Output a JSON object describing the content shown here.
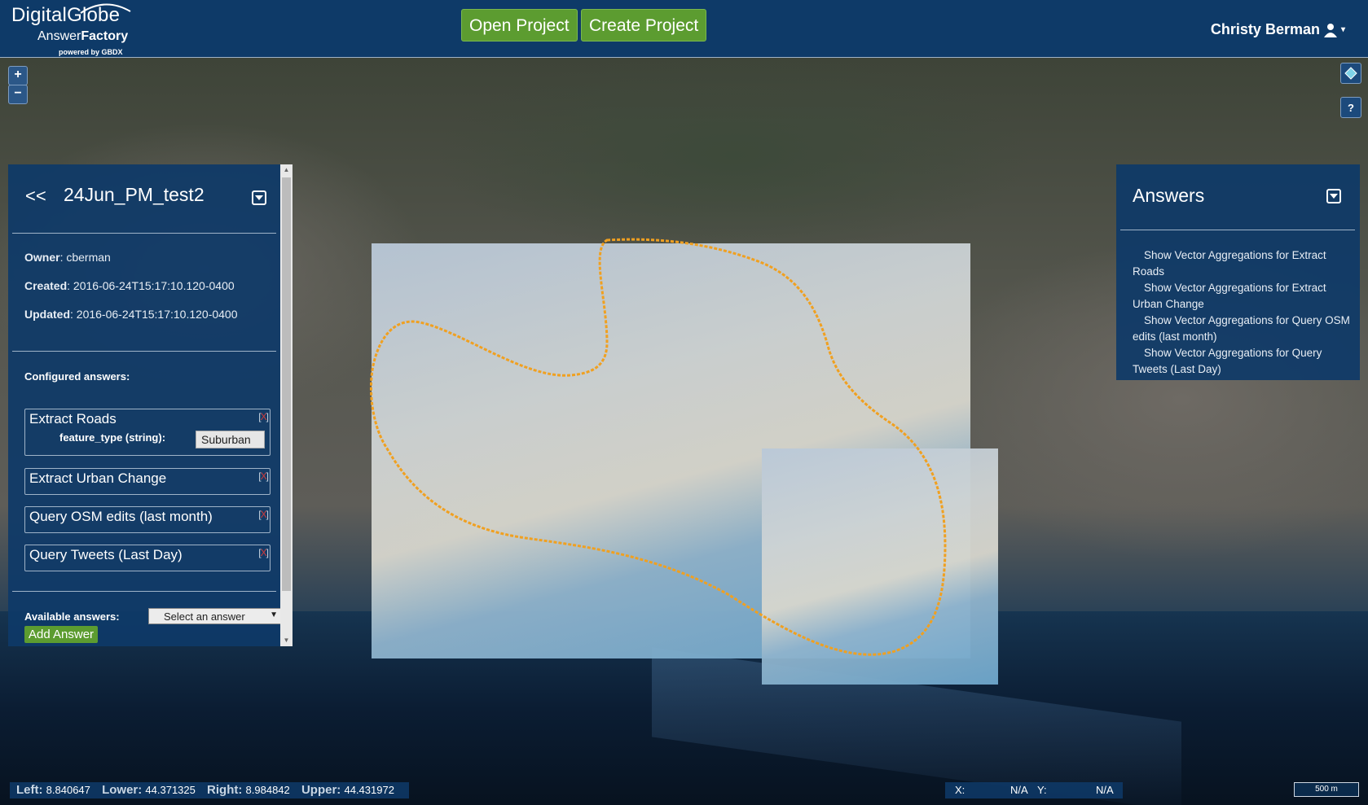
{
  "header": {
    "logo_main": "DigitalGlobe",
    "logo_sub_a": "Answer",
    "logo_sub_b": "Factory",
    "logo_powered": "powered by GBDX",
    "open_project": "Open Project",
    "create_project": "Create Project",
    "user_name": "Christy Berman"
  },
  "map_controls": {
    "zoom_in": "+",
    "zoom_out": "−",
    "help": "?"
  },
  "project": {
    "back": "<<",
    "title": "24Jun_PM_test2",
    "owner_label": "Owner",
    "owner": ": cberman",
    "created_label": "Created",
    "created": ": 2016-06-24T15:17:10.120-0400",
    "updated_label": "Updated",
    "updated": ": 2016-06-24T15:17:10.120-0400",
    "configured_label": "Configured answers:",
    "answers": [
      {
        "name": "Extract Roads",
        "param_label": "feature_type (string):",
        "param_value": "Suburban"
      },
      {
        "name": "Extract Urban Change"
      },
      {
        "name": "Query OSM edits (last month)"
      },
      {
        "name": "Query Tweets (Last Day)"
      }
    ],
    "remove_mark": "X",
    "available_label": "Available answers:",
    "select_placeholder": "Select an answer",
    "add_button": "Add Answer"
  },
  "answers_panel": {
    "title": "Answers",
    "links": [
      "Show Vector Aggregations for Extract Roads",
      "Show Vector Aggregations for Extract Urban Change",
      "Show Vector Aggregations for Query OSM edits (last month)",
      "Show Vector Aggregations for Query Tweets (Last Day)"
    ]
  },
  "footer": {
    "left_label": "Left:",
    "left": "8.840647",
    "lower_label": "Lower:",
    "lower": "44.371325",
    "right_label": "Right:",
    "right": "8.984842",
    "upper_label": "Upper:",
    "upper": "44.431972",
    "x_label": "X:",
    "x_value": "N/A",
    "y_label": "Y:",
    "y_value": "N/A",
    "scale": "500 m"
  },
  "colors": {
    "navy": "#0e3a68",
    "green": "#5c9c30",
    "aoi": "#f0a020",
    "remove": "#d23b3b"
  }
}
